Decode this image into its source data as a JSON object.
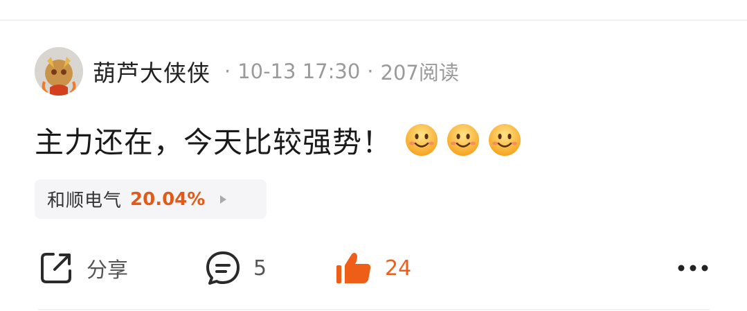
{
  "post": {
    "author": "葫芦大侠侠",
    "date": "10-13 17:30",
    "views": "207阅读",
    "separator": "·",
    "content": "主力还在，今天比较强势！",
    "emojis": [
      "smile-emoji",
      "smile-emoji",
      "smile-emoji"
    ]
  },
  "stock": {
    "name": "和顺电气",
    "change": "20.04%",
    "change_color": "#e05a1a"
  },
  "actions": {
    "share_label": "分享",
    "comment_count": "5",
    "like_count": "24",
    "like_color": "#ef5e18"
  },
  "icons": {
    "share": "share-icon",
    "comment": "comment-icon",
    "like": "thumbs-up-icon",
    "more": "more-icon"
  }
}
